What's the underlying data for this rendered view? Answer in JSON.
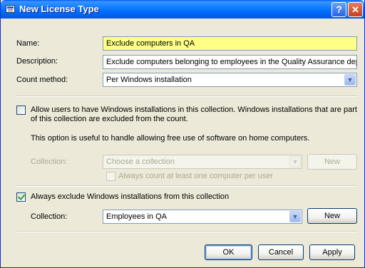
{
  "window": {
    "title": "New License Type"
  },
  "form": {
    "name_label": "Name:",
    "name_value": "Exclude computers in QA",
    "description_label": "Description:",
    "description_value": "Exclude computers belonging to employees in the Quality Assurance depa",
    "count_method_label": "Count method:",
    "count_method_value": "Per Windows installation"
  },
  "allow_section": {
    "checkbox_label_line1": "Allow users to have Windows installations in this collection. Windows installations that are part",
    "checkbox_label_line2": "of this collection are excluded from the count.",
    "checked": false,
    "info": "This option is useful to handle allowing free use of software on home computers.",
    "collection_label": "Collection:",
    "collection_placeholder": "Choose a collection",
    "new_label": "New",
    "min_count_label": "Always count at least one computer per user"
  },
  "exclude_section": {
    "checkbox_label": "Always exclude Windows installations from this collection",
    "checked": true,
    "collection_label": "Collection:",
    "collection_value": "Employees in QA",
    "new_label": "New"
  },
  "footer": {
    "ok_label": "OK",
    "cancel_label": "Cancel",
    "apply_label": "Apply"
  },
  "colors": {
    "titlebar": "#0058EE",
    "highlight_field": "#FFFF88",
    "dialog_bg": "#ECE9D8"
  }
}
